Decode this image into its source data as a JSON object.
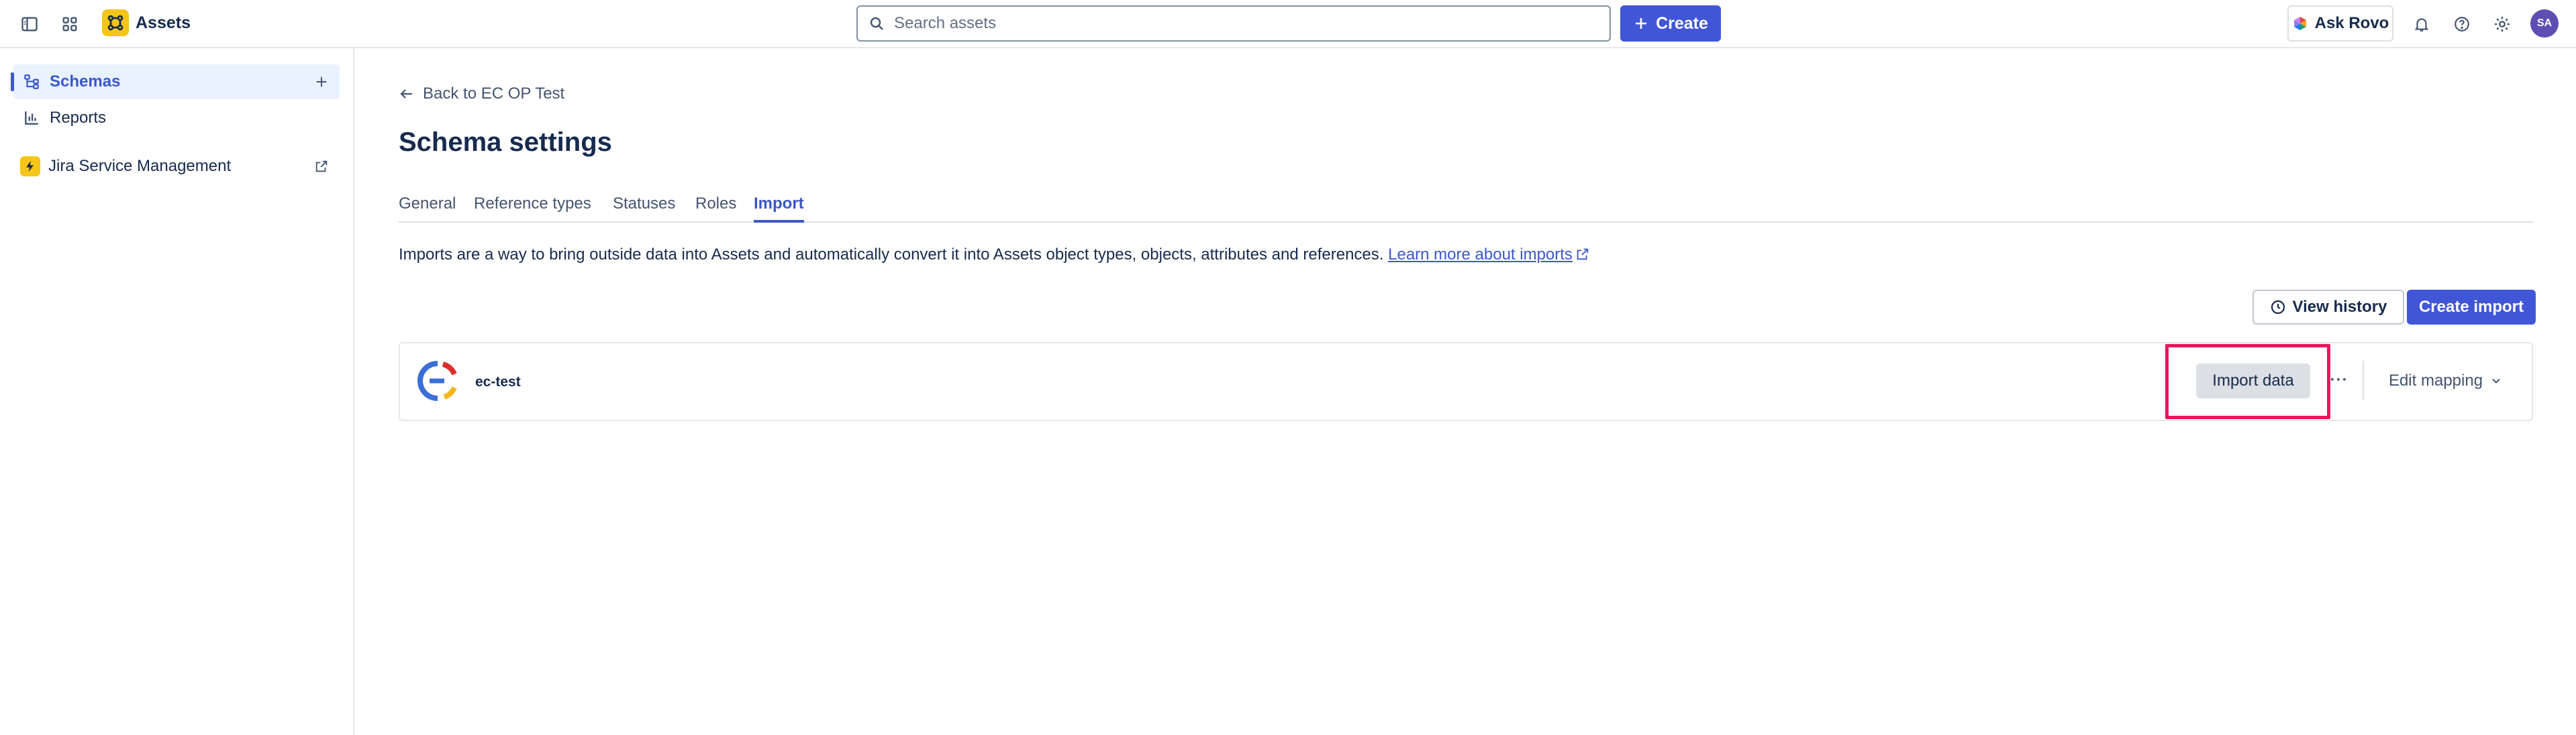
{
  "topbar": {
    "app_name": "Assets",
    "search_placeholder": "Search assets",
    "create_label": "Create",
    "ask_rovo_label": "Ask Rovo",
    "avatar_initials": "SA",
    "icons": [
      "sidebar-toggle-icon",
      "app-switcher-icon",
      "search-icon",
      "plus-icon",
      "bell-icon",
      "help-icon",
      "settings-icon"
    ]
  },
  "sidebar": {
    "items": [
      {
        "label": "Schemas",
        "icon": "schema-icon",
        "active": true
      },
      {
        "label": "Reports",
        "icon": "chart-icon",
        "active": false
      },
      {
        "label": "Jira Service Management",
        "icon": "jsm-logo",
        "active": false
      }
    ]
  },
  "main": {
    "back_label": "Back to EC OP Test",
    "title": "Schema settings",
    "tabs": [
      {
        "label": "General",
        "active": false
      },
      {
        "label": "Reference types",
        "active": false
      },
      {
        "label": "Statuses",
        "active": false
      },
      {
        "label": "Roles",
        "active": false
      },
      {
        "label": "Import",
        "active": true
      }
    ],
    "description": "Imports are a way to bring outside data into Assets and automatically convert it into Assets object types, objects, attributes and references.",
    "learn_more_label": "Learn more about imports",
    "view_history_label": "View history",
    "create_import_label": "Create import",
    "imports": [
      {
        "name": "ec-test",
        "import_data_label": "Import data",
        "more_label": "···",
        "edit_mapping_label": "Edit mapping"
      }
    ]
  },
  "colors": {
    "accent": "#4156d6",
    "highlight": "#e8175d",
    "active_nav_bg": "#e9f2ff",
    "avatar_bg": "#5e4db2"
  }
}
